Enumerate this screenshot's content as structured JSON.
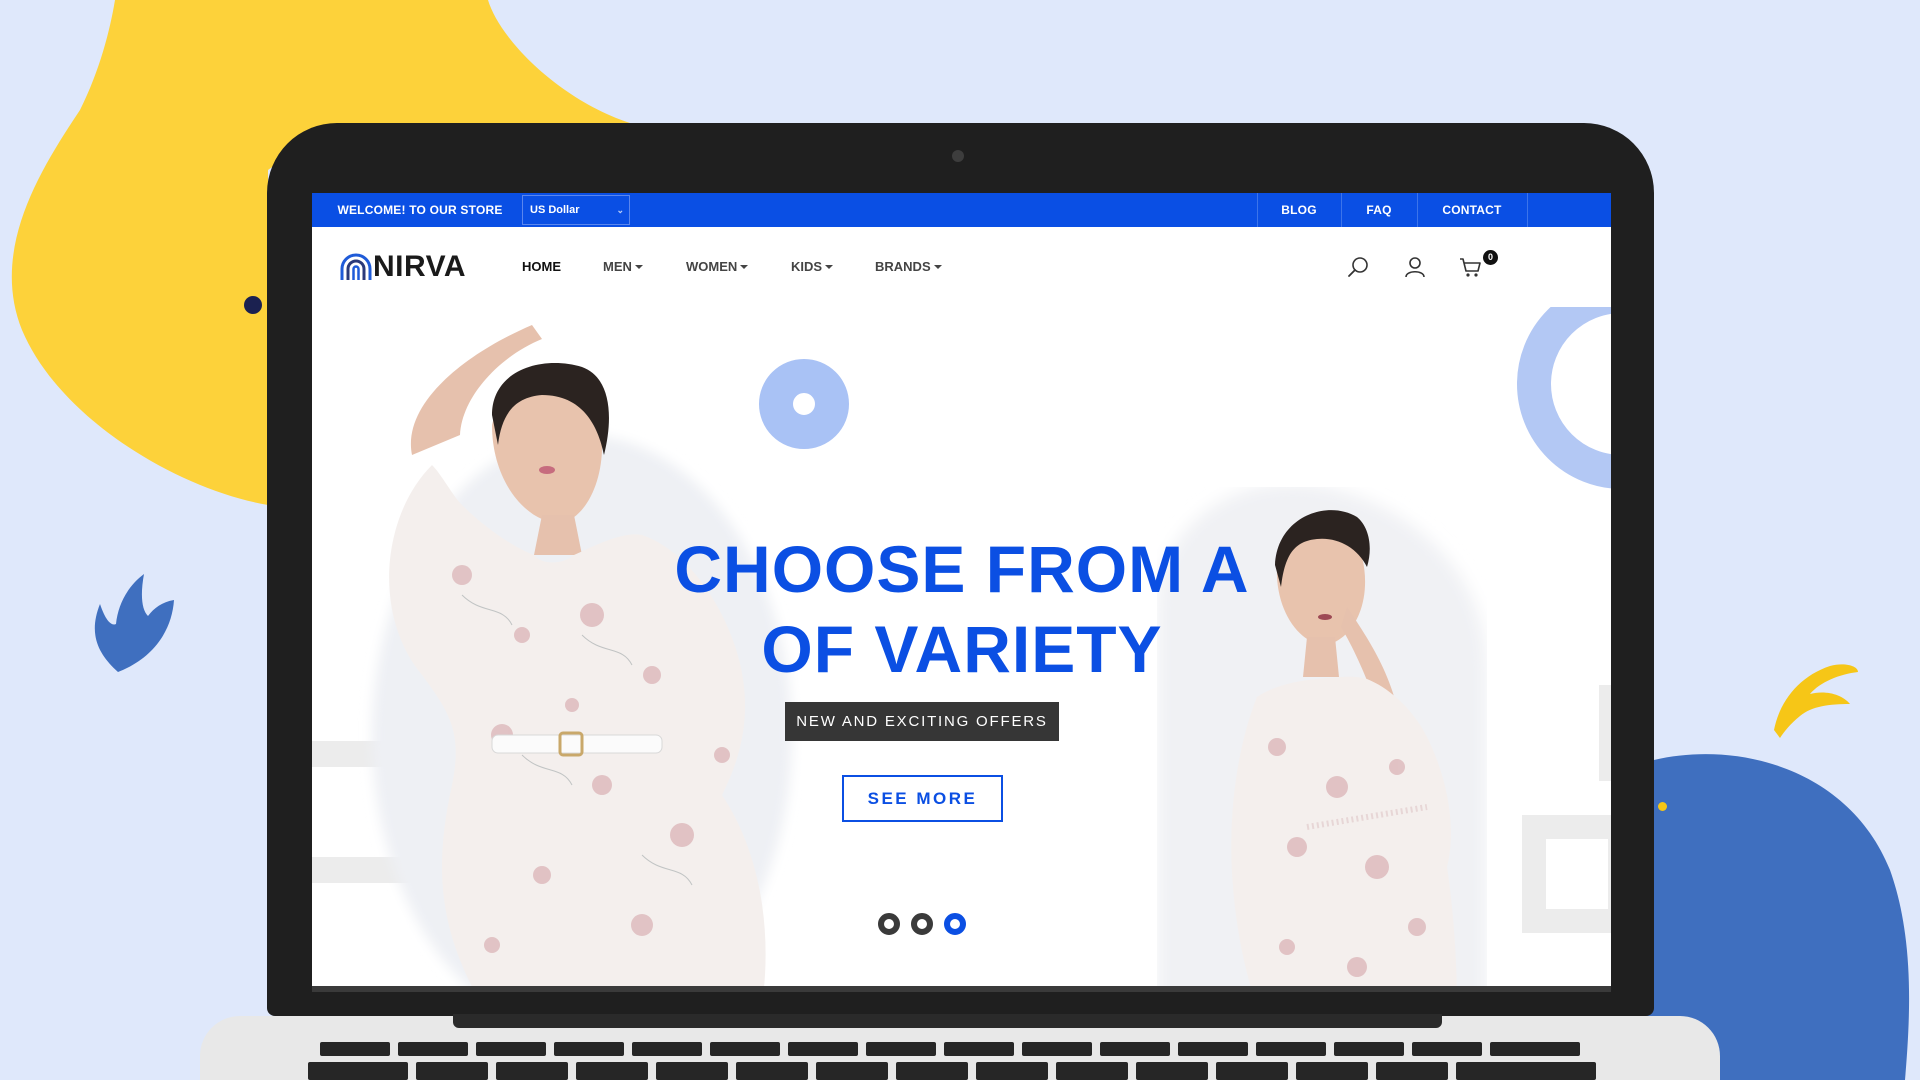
{
  "topbar": {
    "welcome": "WELCOME! TO OUR STORE",
    "currency": "US Dollar",
    "links": [
      "BLOG",
      "FAQ",
      "CONTACT"
    ]
  },
  "navbar": {
    "logo_text": "NIRVA",
    "items": [
      {
        "label": "HOME",
        "dropdown": false
      },
      {
        "label": "MEN",
        "dropdown": true
      },
      {
        "label": "WOMEN",
        "dropdown": true
      },
      {
        "label": "KIDS",
        "dropdown": true
      },
      {
        "label": "BRANDS",
        "dropdown": true
      }
    ],
    "icons": [
      "search-icon",
      "user-icon",
      "cart-icon"
    ],
    "cart_count": "0"
  },
  "hero": {
    "headline_line1": "CHOOSE FROM A",
    "headline_line2": "OF VARIETY",
    "badge": "NEW AND EXCITING OFFERS",
    "cta": "SEE MORE",
    "slides_total": 3,
    "active_slide": 3
  },
  "colors": {
    "primary_blue": "#0a4fe4",
    "background": "#dfe8fb",
    "accent_yellow": "#fdd23a",
    "accent_blue": "#3f6fbf",
    "dark": "#1f1f1f"
  }
}
